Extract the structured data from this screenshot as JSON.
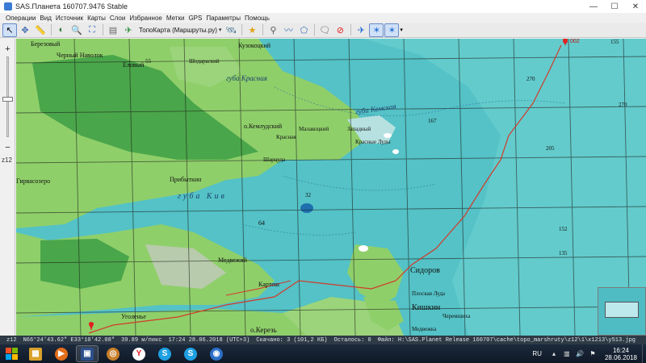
{
  "window": {
    "title": "SAS.Планета 160707.9476 Stable",
    "controls": {
      "minimize": "—",
      "maximize": "☐",
      "close": "✕"
    }
  },
  "menu": [
    "Операции",
    "Вид",
    "Источник",
    "Карты",
    "Слои",
    "Избранное",
    "Метки",
    "GPS",
    "Параметры",
    "Помощь"
  ],
  "toolbar": {
    "map_source": "ТопоКарта (Маршруты.ру)",
    "tools": [
      "cursor-arrow",
      "move",
      "ruler",
      "map-type",
      "zoom",
      "fullscreen",
      "layers",
      "map-source",
      "satellite",
      "favorites-star",
      "placemark",
      "polyline",
      "polygon",
      "add-label",
      "stop",
      "gps-track",
      "gps-center",
      "gps-follow"
    ]
  },
  "zoom_panel": {
    "plus": "+",
    "minus": "−",
    "zoom_label": "z12",
    "level_fraction": 0.7
  },
  "map": {
    "labels": [
      "Березовый",
      "Черный Наволок",
      "Еловый",
      "Кузокоцкий",
      "Шодараский",
      "губа Красная",
      "губа Кемская",
      "о.Кемлудский",
      "Малакоцкий",
      "Западный",
      "Красная",
      "Красные Луды",
      "Шарцуда",
      "Гирвасозеро",
      "Прибыткин",
      "губа Кив",
      "Медвежий",
      "Картеш",
      "Сидоров",
      "Плоская Луда",
      "Кишкин",
      "Черемшиха",
      "Медвежка",
      "о.Керезь",
      "Уголенье"
    ],
    "depths": [
      "55",
      "270",
      "205",
      "270",
      "152",
      "155",
      "135",
      "167",
      "32",
      "64"
    ],
    "marker_label": "002"
  },
  "statusbar": {
    "zoom": "z12",
    "coords": "N66°24'43.62\" E33°10'42.08\"",
    "scale": "39.89 м/пикс",
    "time": "17:24 28.06.2018 (UTC+3)",
    "downloaded": "Скачано: 3 (101,2 КБ)",
    "remaining": "Осталось: 0",
    "file": "Файл: H:\\SAS.Planet Release 160707\\cache\\topo_marshruty\\z12\\1\\x1213\\y513.jpg"
  },
  "taskbar": {
    "apps": [
      {
        "name": "explorer",
        "color": "#d9a12a",
        "glyph": "▦"
      },
      {
        "name": "media",
        "color": "#e36d1a",
        "glyph": "▶"
      },
      {
        "name": "sas-planet",
        "color": "#2c4f8a",
        "glyph": "▣"
      },
      {
        "name": "settings",
        "color": "#c77f2a",
        "glyph": "◎"
      },
      {
        "name": "yandex-browser",
        "color": "#ffffff",
        "glyph": "Y"
      },
      {
        "name": "skype",
        "color": "#1fa0e3",
        "glyph": "S"
      },
      {
        "name": "skype-2",
        "color": "#1fa0e3",
        "glyph": "S"
      },
      {
        "name": "google-earth",
        "color": "#2b6fc7",
        "glyph": "◉"
      }
    ],
    "language": "RU",
    "clock_time": "16:24",
    "clock_date": "28.06.2018"
  }
}
